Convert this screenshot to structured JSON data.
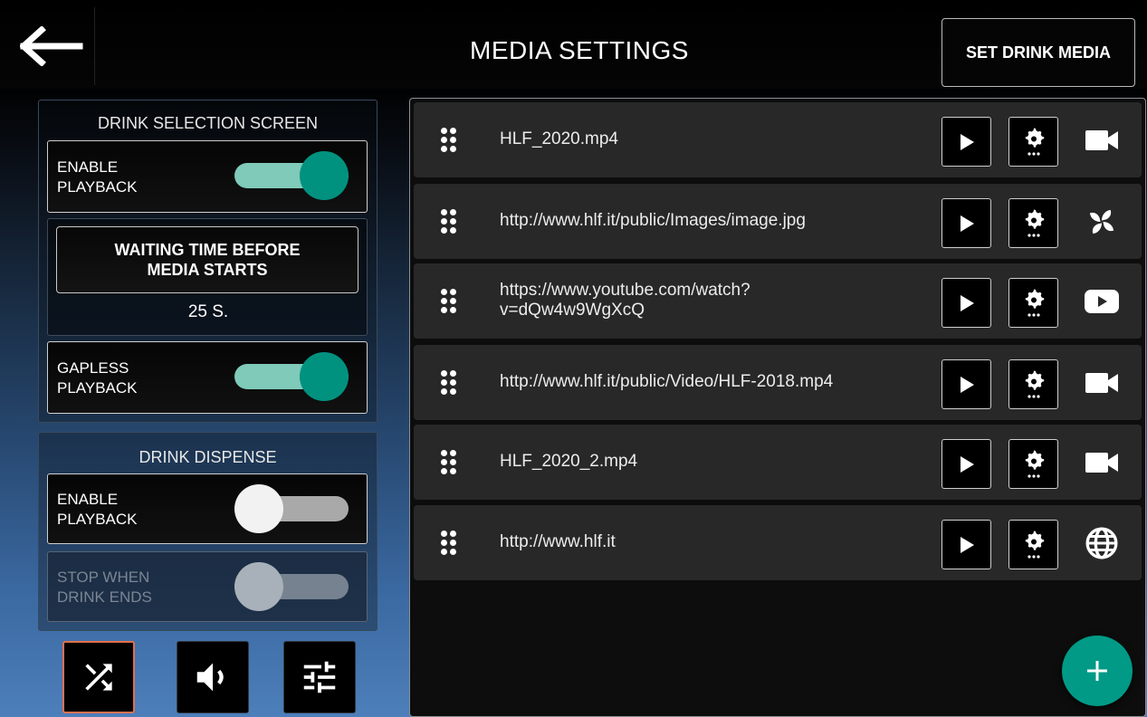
{
  "header": {
    "title": "MEDIA SETTINGS",
    "back_icon": "arrow-left-icon",
    "set_drink_media_label": "SET DRINK MEDIA"
  },
  "drink_selection": {
    "title": "DRINK SELECTION SCREEN",
    "enable_playback": {
      "label": "ENABLE\nPLAYBACK",
      "on": true
    },
    "waiting_time": {
      "button_label": "WAITING TIME BEFORE\nMEDIA STARTS",
      "value": "25 S."
    },
    "gapless_playback": {
      "label": "GAPLESS\nPLAYBACK",
      "on": true
    }
  },
  "drink_dispense": {
    "title": "DRINK DISPENSE",
    "enable_playback": {
      "label": "ENABLE\nPLAYBACK",
      "on": false
    },
    "stop_when_ends": {
      "label": "STOP WHEN\nDRINK ENDS",
      "on": false,
      "disabled": true
    }
  },
  "bottom_buttons": [
    {
      "icon": "shuffle-icon",
      "active": true
    },
    {
      "icon": "volume-icon",
      "active": false
    },
    {
      "icon": "equalizer-icon",
      "active": false
    }
  ],
  "media": [
    {
      "url": "HLF_2020.mp4",
      "type_icon": "video-camera-icon"
    },
    {
      "url": "http://www.hlf.it/public/Images/image.jpg",
      "type_icon": "pinwheel-image-icon"
    },
    {
      "url": "https://www.youtube.com/watch?\nv=dQw4w9WgXcQ",
      "type_icon": "youtube-icon"
    },
    {
      "url": "http://www.hlf.it/public/Video/HLF-2018.mp4",
      "type_icon": "video-camera-icon"
    },
    {
      "url": "HLF_2020_2.mp4",
      "type_icon": "video-camera-icon"
    },
    {
      "url": "http://www.hlf.it",
      "type_icon": "globe-icon"
    }
  ],
  "fab_icon": "plus-icon",
  "colors": {
    "accent": "#00927f",
    "toggle_track_on": "#7fcab9",
    "active_border": "#e07050"
  }
}
